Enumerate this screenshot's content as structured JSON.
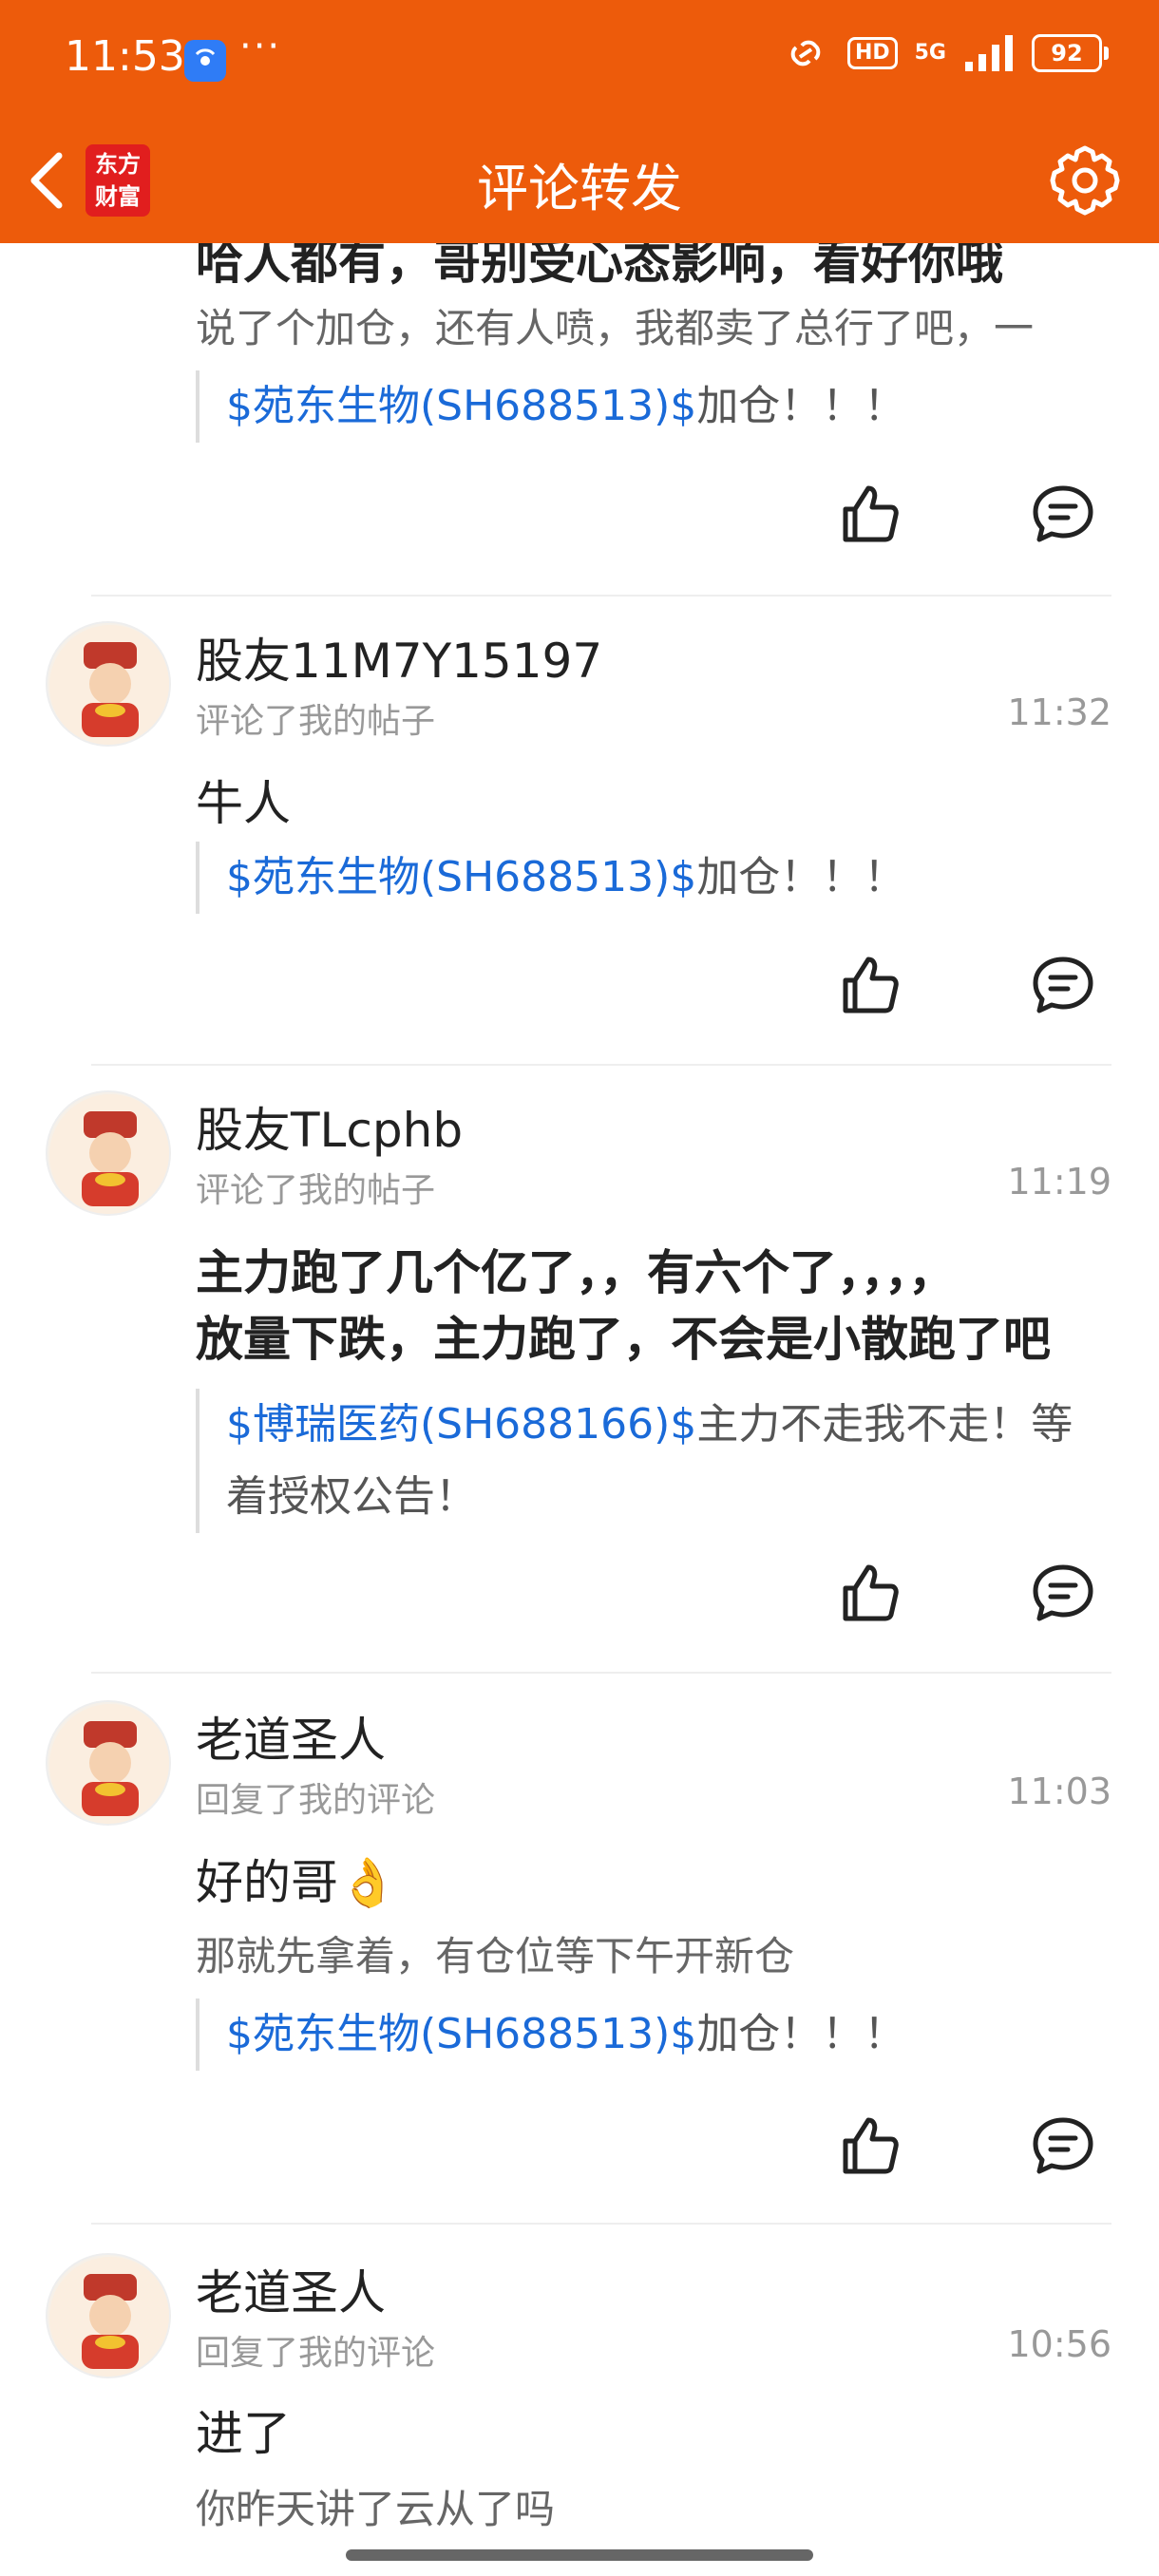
{
  "status_bar": {
    "time": "11:53",
    "dots": "···",
    "hd": "HD",
    "network": "5G",
    "battery": "92"
  },
  "nav": {
    "logo_line1": "东方",
    "logo_line2": "财富",
    "title": "评论转发"
  },
  "items": [
    {
      "clipped_main": "哈人都有，哥别受心态影响，看好你哦",
      "sub": "说了个加仓，还有人喷，我都卖了总行了吧，一",
      "quote_stock": "$苑东生物(SH688513)$",
      "quote_text": "加仓！！！"
    },
    {
      "username": "股友11M7Y15197",
      "action": "评论了我的帖子",
      "time": "11:32",
      "main": "牛人",
      "quote_stock": "$苑东生物(SH688513)$",
      "quote_text": "加仓！！！"
    },
    {
      "username": "股友TLcphb",
      "action": "评论了我的帖子",
      "time": "11:19",
      "main_line1": "主力跑了几个亿了，，有六个了，，，，",
      "main_line2": "放量下跌，主力跑了，不会是小散跑了吧",
      "quote_stock": "$博瑞医药(SH688166)$",
      "quote_text": "主力不走我不走！等着授权公告！"
    },
    {
      "username": "老道圣人",
      "action": "回复了我的评论",
      "time": "11:03",
      "main": "好的哥👌",
      "sub": "那就先拿着，有仓位等下午开新仓",
      "quote_stock": "$苑东生物(SH688513)$",
      "quote_text": "加仓！！！"
    },
    {
      "username": "老道圣人",
      "action": "回复了我的评论",
      "time": "10:56",
      "main": "进了",
      "sub": "你昨天讲了云从了吗"
    }
  ]
}
